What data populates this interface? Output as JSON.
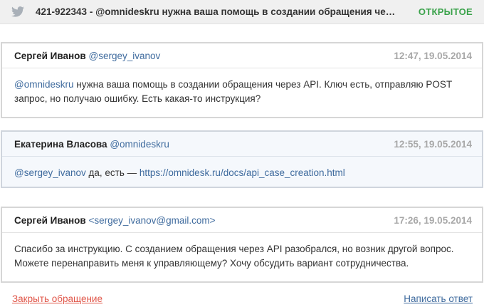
{
  "header": {
    "subject": "421-922343 - @omnideskru нужна ваша помощь в создании обращения чер...",
    "status": "ОТКРЫТОЕ",
    "channel_icon": "twitter-bird-icon"
  },
  "messages": [
    {
      "type": "customer",
      "name": "Сергей Иванов",
      "handle": "@sergey_ivanov",
      "time": "12:47, 19.05.2014",
      "mention": "@omnideskru",
      "text": " нужна ваша помощь в создании обращения через API. Ключ есть, отправляю POST запрос, но получаю ошибку. Есть какая-то инструкция?"
    },
    {
      "type": "agent",
      "name": "Екатерина Власова",
      "handle": "@omnideskru",
      "time": "12:55, 19.05.2014",
      "mention": "@sergey_ivanov",
      "text_before_link": " да, есть — ",
      "link": "https://omnidesk.ru/docs/api_case_creation.html"
    },
    {
      "type": "customer",
      "name": "Сергей Иванов",
      "handle": "<sergey_ivanov@gmail.com>",
      "time": "17:26, 19.05.2014",
      "text": "Спасибо за инструкцию. С созданием обращения через API разобрался, но возник другой вопрос. Можете перенаправить меня к управляющему? Хочу обсудить вариант сотрудничества."
    }
  ],
  "actions": {
    "close_label": "Закрыть обращение",
    "reply_label": "Написать ответ"
  },
  "colors": {
    "status": "#3aa24a",
    "link": "#3f6b9e",
    "close": "#e0574a",
    "agent_bg": "#f5f8fc"
  }
}
